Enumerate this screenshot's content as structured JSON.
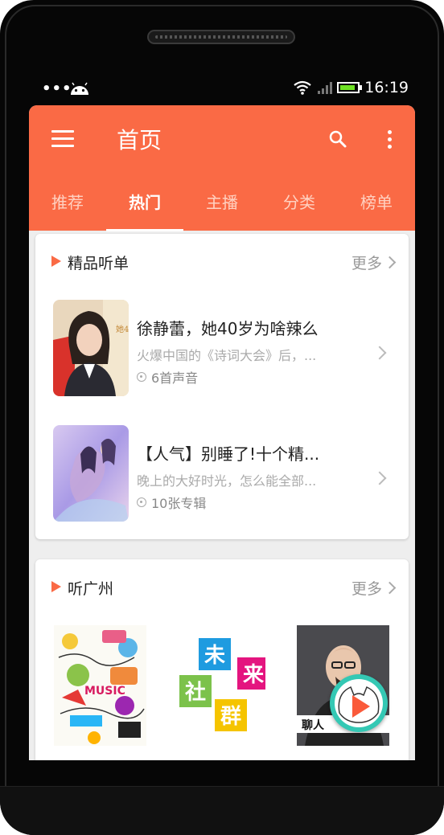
{
  "status_bar": {
    "notification_dots": "•••",
    "time": "16:19",
    "battery_level": 0.7
  },
  "appbar": {
    "title": "首页"
  },
  "tabs": [
    {
      "label": "推荐",
      "active": false
    },
    {
      "label": "热门",
      "active": true
    },
    {
      "label": "主播",
      "active": false
    },
    {
      "label": "分类",
      "active": false
    },
    {
      "label": "榜单",
      "active": false
    }
  ],
  "section_featured": {
    "title": "精品听单",
    "more_label": "更多",
    "items": [
      {
        "title": "徐静蕾，她40岁为啥辣么",
        "description": "火爆中国的《诗词大会》后，...",
        "meta": "6首声音",
        "thumb_text": "她40岁"
      },
      {
        "title": "【人气】别睡了!十个精...",
        "description": "晚上的大好时光，怎么能全部...",
        "meta": "10张专辑"
      }
    ]
  },
  "section_guangzhou": {
    "title": "听广州",
    "more_label": "更多",
    "tiles": [
      {
        "text": "MUSIC"
      },
      {
        "chars": [
          "未",
          "来",
          "社",
          "群"
        ]
      },
      {
        "caption": "聊人"
      }
    ]
  },
  "colors": {
    "accent": "#fa6a45",
    "fab": "#34c8b4"
  },
  "icons": {
    "menu": "menu-icon",
    "search": "search-icon",
    "more": "more-vertical-icon",
    "play": "play-icon"
  }
}
